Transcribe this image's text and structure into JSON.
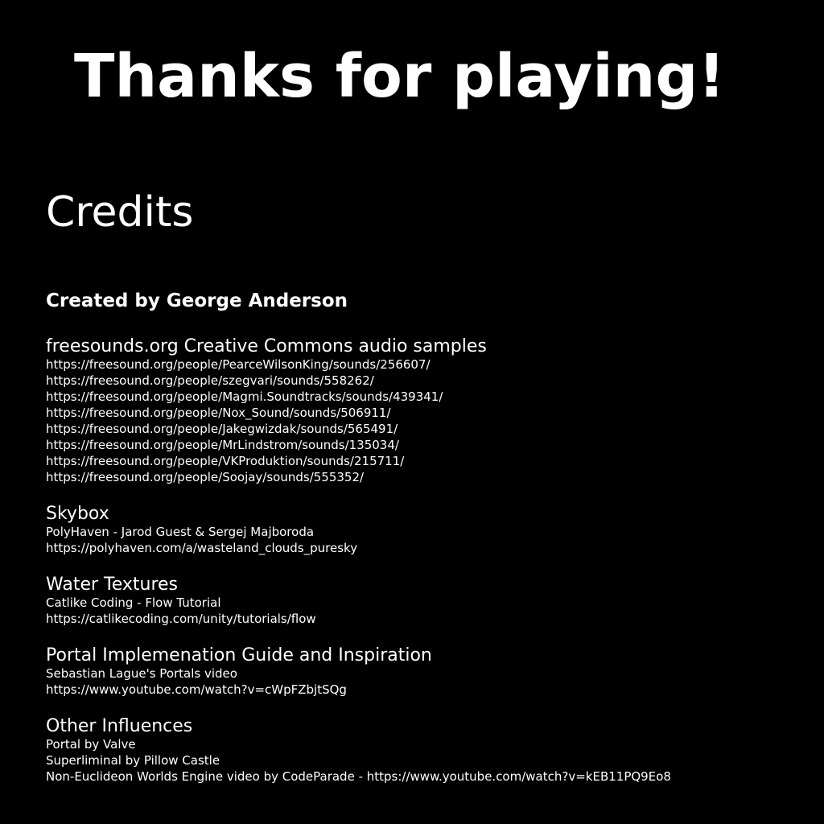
{
  "title": "Thanks for playing!",
  "credits_heading": "Credits",
  "creator": "Created by George Anderson",
  "sections": [
    {
      "title": "freesounds.org Creative Commons audio samples",
      "lines": [
        "https://freesound.org/people/PearceWilsonKing/sounds/256607/",
        "https://freesound.org/people/szegvari/sounds/558262/",
        "https://freesound.org/people/Magmi.Soundtracks/sounds/439341/",
        "https://freesound.org/people/Nox_Sound/sounds/506911/",
        "https://freesound.org/people/Jakegwizdak/sounds/565491/",
        "https://freesound.org/people/MrLindstrom/sounds/135034/",
        "https://freesound.org/people/VKProduktion/sounds/215711/",
        "https://freesound.org/people/Soojay/sounds/555352/"
      ]
    },
    {
      "title": "Skybox",
      "lines": [
        "PolyHaven - Jarod Guest & Sergej Majboroda",
        "https://polyhaven.com/a/wasteland_clouds_puresky"
      ]
    },
    {
      "title": "Water Textures",
      "lines": [
        "Catlike Coding - Flow Tutorial",
        "https://catlikecoding.com/unity/tutorials/flow"
      ]
    },
    {
      "title": "Portal Implemenation Guide and Inspiration",
      "lines": [
        "Sebastian Lague's Portals video",
        "https://www.youtube.com/watch?v=cWpFZbjtSQg"
      ]
    },
    {
      "title": "Other Influences",
      "lines": [
        "Portal by Valve",
        "Superliminal by Pillow Castle",
        "Non-Euclideon Worlds Engine video by CodeParade - https://www.youtube.com/watch?v=kEB11PQ9Eo8"
      ]
    }
  ]
}
